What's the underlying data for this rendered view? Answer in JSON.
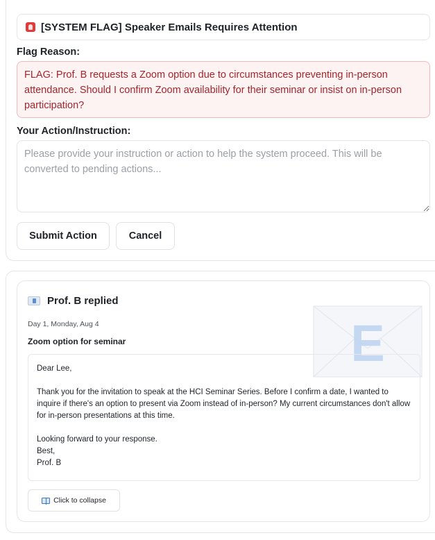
{
  "flag": {
    "title": "[SYSTEM FLAG] Speaker Emails Requires Attention",
    "reason_label": "Flag Reason:",
    "reason_text": "FLAG: Prof. B requests a Zoom option due to circumstances preventing in-person attendance. Should I confirm Zoom availability for their seminar or insist on in-person participation?",
    "action_label": "Your Action/Instruction:",
    "action_value": "",
    "action_placeholder": "Please provide your instruction or action to help the system proceed. This will be converted to pending actions...",
    "submit_label": "Submit Action",
    "cancel_label": "Cancel"
  },
  "email": {
    "header": "Prof. B replied",
    "date": "Day 1, Monday, Aug 4",
    "subject": "Zoom option for seminar",
    "body": "Dear Lee,\n\nThank you for the invitation to speak at the HCI Seminar Series. Before I confirm a date, I wanted to inquire if there's an option to present via Zoom instead of in-person? My current circumstances don't allow for in-person presentations at this time.\n\nLooking forward to your response.\nBest,\nProf. B",
    "collapse_label": "Click to collapse",
    "watermark_letter": "E"
  },
  "colors": {
    "flag_red": "#a1272d",
    "flag_bg": "#fdf3f3",
    "flag_border": "#f1b9b9",
    "watermark_blue": "#bcd3f0"
  },
  "icons": {
    "flag_icon": "siren-icon",
    "email_icon": "envelope-icon",
    "collapse_icon": "book-icon"
  }
}
